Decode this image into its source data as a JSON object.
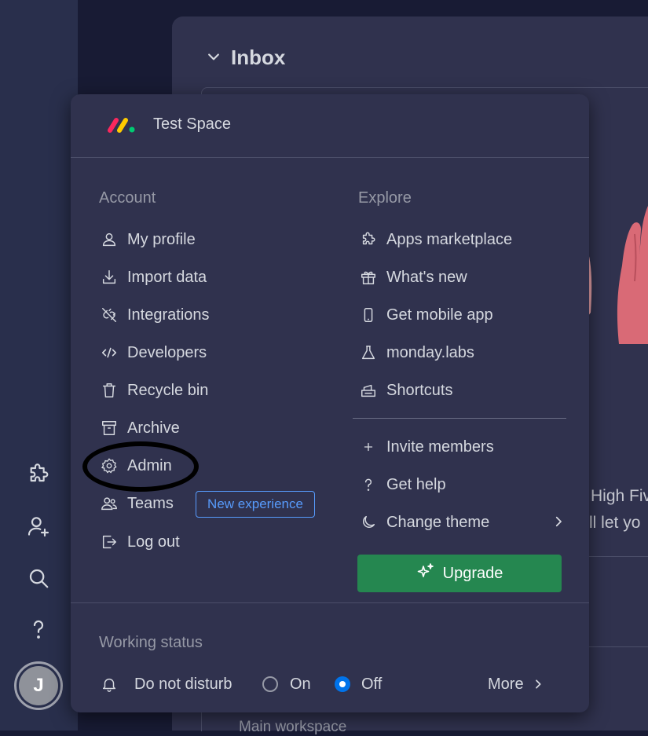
{
  "inbox": {
    "title": "Inbox"
  },
  "background": {
    "line1": "High Fiv",
    "line2": "'ll let yo",
    "workspace": "Main workspace"
  },
  "menu": {
    "space_name": "Test Space",
    "account": {
      "title": "Account",
      "items": [
        {
          "label": "My profile",
          "icon": "user-icon"
        },
        {
          "label": "Import data",
          "icon": "download-icon"
        },
        {
          "label": "Integrations",
          "icon": "plug-icon"
        },
        {
          "label": "Developers",
          "icon": "code-icon"
        },
        {
          "label": "Recycle bin",
          "icon": "trash-icon"
        },
        {
          "label": "Archive",
          "icon": "archive-icon"
        },
        {
          "label": "Admin",
          "icon": "gear-icon"
        },
        {
          "label": "Teams",
          "icon": "team-icon"
        },
        {
          "label": "Log out",
          "icon": "logout-icon"
        }
      ],
      "teams_badge": "New experience"
    },
    "explore": {
      "title": "Explore",
      "items": [
        {
          "label": "Apps marketplace",
          "icon": "puzzle-icon"
        },
        {
          "label": "What's new",
          "icon": "gift-icon"
        },
        {
          "label": "Get mobile app",
          "icon": "mobile-icon"
        },
        {
          "label": "monday.labs",
          "icon": "flask-icon"
        },
        {
          "label": "Shortcuts",
          "icon": "keyboard-icon"
        }
      ],
      "secondary": [
        {
          "label": "Invite members",
          "icon": "plus-icon"
        },
        {
          "label": "Get help",
          "icon": "question-icon"
        },
        {
          "label": "Change theme",
          "icon": "moon-icon"
        }
      ]
    },
    "upgrade_label": "Upgrade",
    "working_status": {
      "title": "Working status",
      "dnd_label": "Do not disturb",
      "on_label": "On",
      "off_label": "Off",
      "selected": "Off",
      "more_label": "More"
    }
  },
  "avatar_initial": "J",
  "colors": {
    "accent_blue": "#0073ea",
    "upgrade_green": "#258750",
    "badge_blue": "#579bfc",
    "menu_bg": "#30324e"
  }
}
